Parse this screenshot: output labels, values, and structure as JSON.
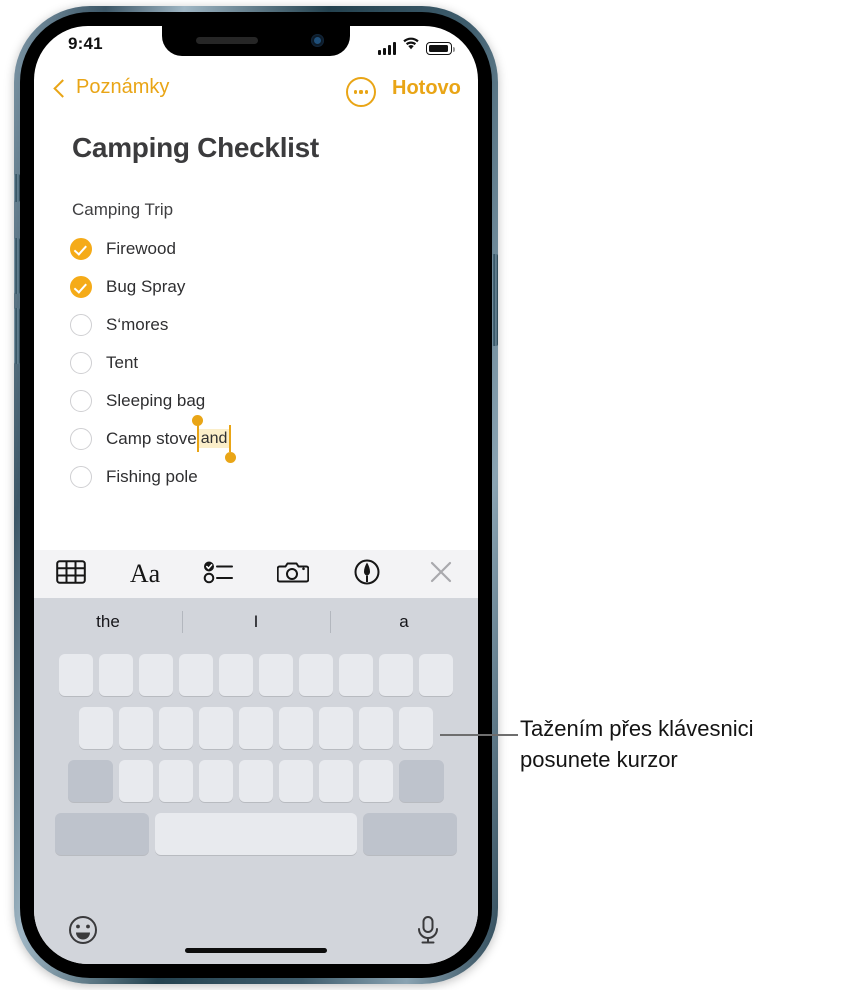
{
  "status_bar": {
    "time": "9:41",
    "signal_icon": "cellular-bars-icon",
    "wifi_icon": "wifi-icon",
    "battery_icon": "battery-full-icon"
  },
  "nav_bar": {
    "back_label": "Poznámky",
    "back_chevron_icon": "chevron-left-icon",
    "more_icon": "ellipsis-circle-icon",
    "done_label": "Hotovo",
    "accent_color": "#e9a516"
  },
  "note": {
    "title": "Camping Checklist",
    "subtitle": "Camping Trip",
    "checklist": [
      {
        "label": "Firewood",
        "checked": true
      },
      {
        "label": "Bug Spray",
        "checked": true
      },
      {
        "label": "S‘mores",
        "checked": false
      },
      {
        "label": "Tent",
        "checked": false
      },
      {
        "label": "Sleeping bag",
        "checked": false
      },
      {
        "label": "Camp stove ",
        "checked": false,
        "selected_text": "and"
      },
      {
        "label": "Fishing pole",
        "checked": false
      }
    ],
    "selection_color": "#fbeec9",
    "checkbox_checked_color": "#f5ab18"
  },
  "format_toolbar": {
    "buttons": [
      {
        "icon": "table-icon",
        "name": "insert-table-button"
      },
      {
        "icon": "text-format-aa-icon",
        "name": "text-format-button"
      },
      {
        "icon": "checklist-icon",
        "name": "checklist-button"
      },
      {
        "icon": "camera-icon",
        "name": "camera-button"
      },
      {
        "icon": "markup-pen-icon",
        "name": "markup-button"
      },
      {
        "icon": "close-x-icon",
        "name": "close-toolbar-button"
      }
    ]
  },
  "predictive_bar": {
    "suggestions": [
      "the",
      "I",
      "a"
    ]
  },
  "keyboard": {
    "row1_keys": 10,
    "row2_keys": 9,
    "row3_keys": 7,
    "shift_key": "shift-key",
    "delete_key": "delete-key",
    "numbers_key": "numbers-key",
    "space_key": "space-key",
    "return_key": "return-key",
    "emoji_icon": "emoji-smiley-icon",
    "mic_icon": "microphone-icon",
    "home_indicator": "home-indicator"
  },
  "callout": {
    "line1": "Tažením přes klávesnici",
    "line2": "posunete kurzor",
    "leader_icon": "leader-line"
  }
}
